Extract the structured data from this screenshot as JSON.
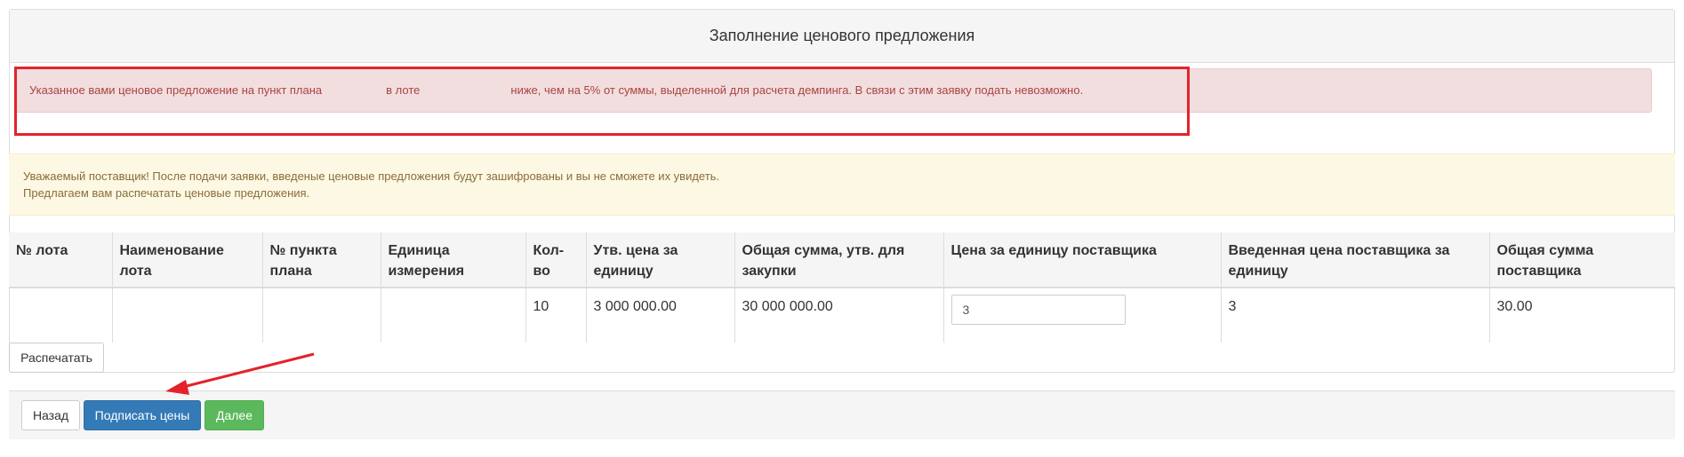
{
  "panel": {
    "title": "Заполнение ценового предложения"
  },
  "alerts": {
    "danger_part1": "Указанное вами ценовое предложение на пункт плана",
    "danger_part2": "в лоте",
    "danger_part3": "ниже, чем на 5% от суммы, выделенной для расчета демпинга. В связи с этим заявку подать невозможно.",
    "warning_line1": "Уважаемый поставщик! После подачи заявки, введеные ценовые предложения будут зашифрованы и вы не сможете их увидеть.",
    "warning_line2": "Предлагаем вам распечатать ценовые предложения."
  },
  "table": {
    "headers": [
      "№ лота",
      "Наименование лота",
      "№ пункта плана",
      "Единица измерения",
      "Кол-во",
      "Утв. цена за единицу",
      "Общая сумма, утв. для закупки",
      "Цена за единицу поставщика",
      "Введенная цена поставщика за единицу",
      "Общая сумма поставщика"
    ],
    "row": {
      "lot_no": "",
      "lot_name": "",
      "plan_item_no": "",
      "unit": "",
      "quantity": "10",
      "approved_unit_price": "3 000 000.00",
      "approved_total": "30 000 000.00",
      "supplier_unit_price_input": "3",
      "entered_supplier_price": "3",
      "supplier_total": "30.00"
    }
  },
  "buttons": {
    "print": "Распечатать",
    "back": "Назад",
    "sign_prices": "Подписать цены",
    "next": "Далее"
  },
  "annotation_colors": {
    "highlight": "#e3232b",
    "arrow": "#e3232b"
  }
}
